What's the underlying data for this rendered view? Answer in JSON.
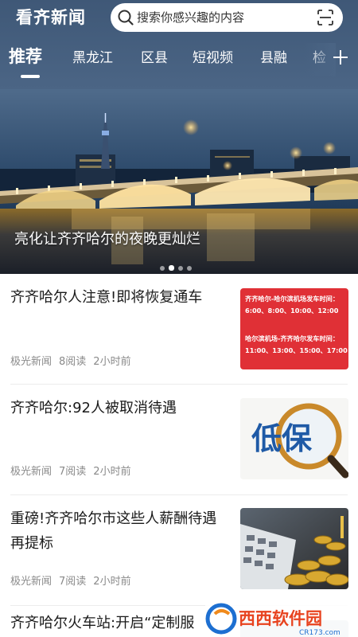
{
  "app": {
    "logo": "看齐新闻",
    "search_placeholder": "搜索你感兴趣的内容",
    "tabs": [
      "推荐",
      "黑龙江",
      "区县",
      "短视频",
      "县融",
      "检"
    ],
    "active_tab": "推荐"
  },
  "banner": {
    "caption": "亮化让齐齐哈尔的夜晚更灿烂",
    "page_count": 4,
    "current_page": 2
  },
  "feed": [
    {
      "title": "齐齐哈尔人注意!即将恢复通车",
      "source": "极光新闻",
      "reads": "8阅读",
      "time": "2小时前",
      "thumb": {
        "line1": "齐齐哈尔-哈尔滨机场发车时间：",
        "line2": "6:00、8:00、10:00、12:00",
        "line3": "哈尔滨机场-齐齐哈尔发车时间：",
        "line4": "11:00、13:00、15:00、17:00"
      }
    },
    {
      "title": "齐齐哈尔:92人被取消待遇",
      "source": "极光新闻",
      "reads": "7阅读",
      "time": "2小时前",
      "thumb": {
        "text": "低保"
      }
    },
    {
      "title": "重磅!齐齐哈尔市这些人薪酬待遇再提标",
      "source": "极光新闻",
      "reads": "7阅读",
      "time": "2小时前"
    },
    {
      "title": "齐齐哈尔火车站:开启“定制服"
    }
  ],
  "watermark": {
    "brand": "西西软件园",
    "url": "CR173.com"
  },
  "colors": {
    "header": "#4b6585",
    "notice_red": "#e03036",
    "dibao_blue": "#1f5aa6"
  }
}
